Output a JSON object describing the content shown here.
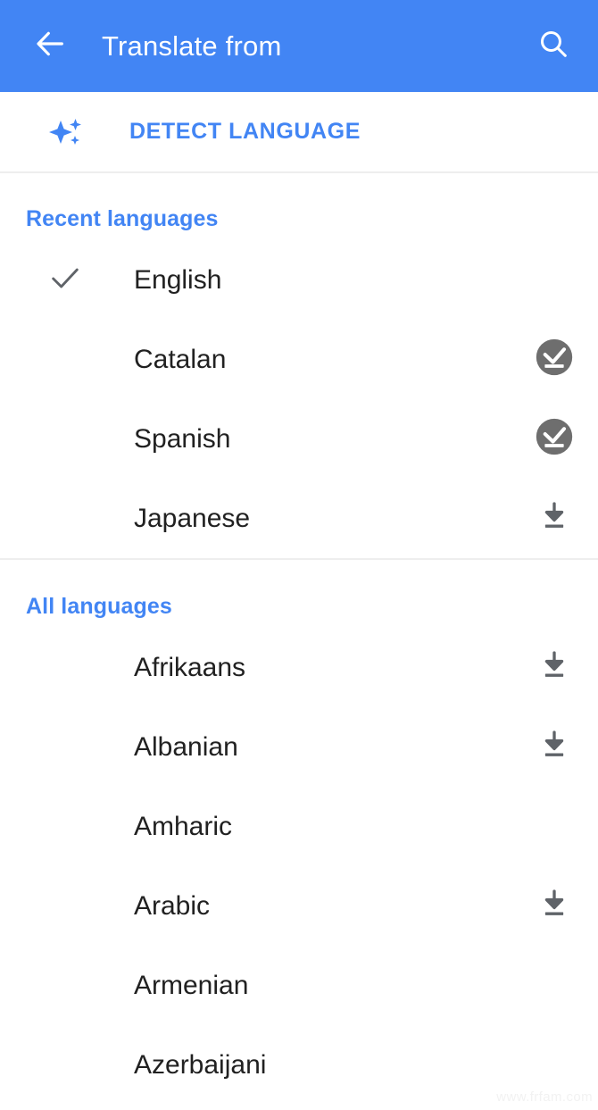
{
  "appbar": {
    "back_icon": "arrow-left-icon",
    "title": "Translate from",
    "search_icon": "search-icon",
    "background_color": "#4285F4",
    "text_color": "#FFFFFF"
  },
  "detect": {
    "icon": "sparkles-icon",
    "label": "DETECT LANGUAGE",
    "color": "#4285F4"
  },
  "sections": [
    {
      "id": "recent",
      "title": "Recent languages",
      "title_color": "#4285F4",
      "items": [
        {
          "name": "English",
          "selected": true,
          "action": "none"
        },
        {
          "name": "Catalan",
          "selected": false,
          "action": "downloaded"
        },
        {
          "name": "Spanish",
          "selected": false,
          "action": "downloaded"
        },
        {
          "name": "Japanese",
          "selected": false,
          "action": "download"
        }
      ]
    },
    {
      "id": "all",
      "title": "All languages",
      "title_color": "#4285F4",
      "items": [
        {
          "name": "Afrikaans",
          "selected": false,
          "action": "download"
        },
        {
          "name": "Albanian",
          "selected": false,
          "action": "download"
        },
        {
          "name": "Amharic",
          "selected": false,
          "action": "none"
        },
        {
          "name": "Arabic",
          "selected": false,
          "action": "download"
        },
        {
          "name": "Armenian",
          "selected": false,
          "action": "none"
        },
        {
          "name": "Azerbaijani",
          "selected": false,
          "action": "none"
        }
      ]
    }
  ],
  "icons": {
    "check": "check-icon",
    "download": "download-icon",
    "downloaded": "downloaded-badge-icon"
  },
  "colors": {
    "accent_blue": "#4285F4",
    "icon_gray": "#5F6368",
    "text_primary": "#212121",
    "divider": "#EEEEEE",
    "downloaded_badge": "#6E6E6E"
  },
  "watermark": "www.frfam.com"
}
